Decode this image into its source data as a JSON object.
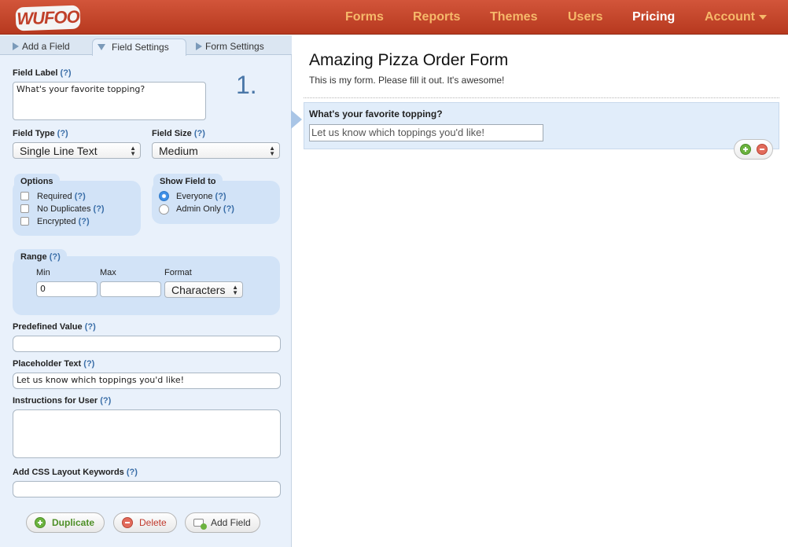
{
  "logo": "WUFOO",
  "nav": [
    {
      "label": "Forms"
    },
    {
      "label": "Reports"
    },
    {
      "label": "Themes"
    },
    {
      "label": "Users"
    },
    {
      "label": "Pricing"
    },
    {
      "label": "Account"
    }
  ],
  "tabs": [
    {
      "label": "Add a Field"
    },
    {
      "label": "Field Settings"
    },
    {
      "label": "Form Settings"
    }
  ],
  "help": "(?)",
  "field_number": "1.",
  "settings": {
    "field_label": {
      "label": "Field Label",
      "value": "What's your favorite topping?"
    },
    "field_type": {
      "label": "Field Type",
      "value": "Single Line Text"
    },
    "field_size": {
      "label": "Field Size",
      "value": "Medium"
    },
    "options": {
      "title": "Options",
      "items": [
        {
          "label": "Required",
          "checked": false
        },
        {
          "label": "No Duplicates",
          "checked": false
        },
        {
          "label": "Encrypted",
          "checked": false
        }
      ]
    },
    "show_field": {
      "title": "Show Field to",
      "items": [
        {
          "label": "Everyone",
          "selected": true
        },
        {
          "label": "Admin Only",
          "selected": false
        }
      ]
    },
    "range": {
      "title": "Range",
      "min_label": "Min",
      "max_label": "Max",
      "format_label": "Format",
      "min_value": "0",
      "max_value": "",
      "format_value": "Characters"
    },
    "predefined_value": {
      "label": "Predefined Value",
      "value": ""
    },
    "placeholder_text": {
      "label": "Placeholder Text",
      "value": "Let us know which toppings you'd like!"
    },
    "instructions": {
      "label": "Instructions for User",
      "value": ""
    },
    "css_keywords": {
      "label": "Add CSS Layout Keywords",
      "value": ""
    }
  },
  "buttons": {
    "duplicate": "Duplicate",
    "delete": "Delete",
    "add_field": "Add Field"
  },
  "form": {
    "title": "Amazing Pizza Order Form",
    "description": "This is my form. Please fill it out. It's awesome!",
    "field_question": "What's your favorite topping?",
    "field_placeholder": "Let us know which toppings you'd like!"
  },
  "colors": {
    "header": "#c2452b",
    "nav_text": "#f6b96a",
    "panel_bg": "#e9f1fb",
    "box_bg": "#d2e3f7",
    "help_link": "#3a6ea8",
    "duplicate_green": "#4e8f27",
    "delete_red": "#c0392b"
  }
}
